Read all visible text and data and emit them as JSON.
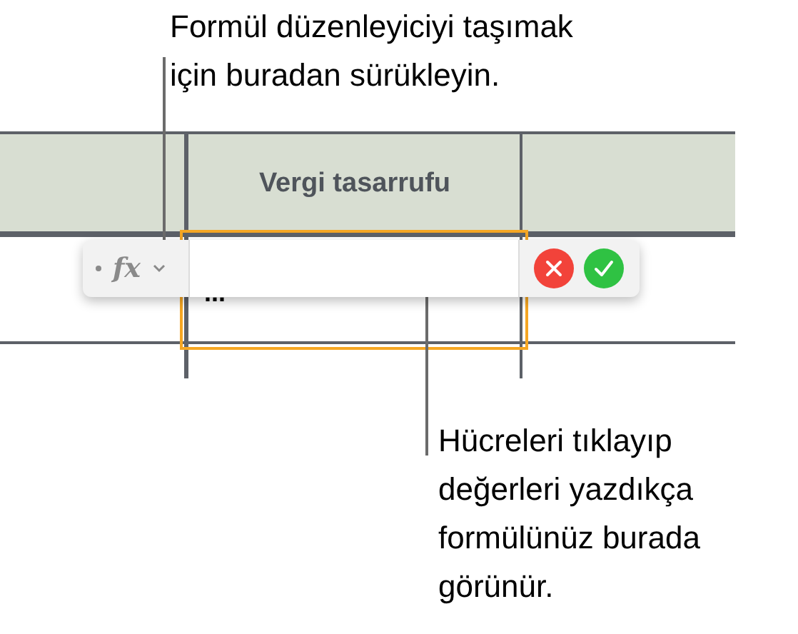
{
  "callouts": [
    {
      "text": "Formül düzenleyiciyi taşımak\niçin buradan sürükleyin."
    },
    {
      "text": "Hücreleri tıklayıp\ndeğerleri yazdıkça\nformülünüz burada\ngörünür."
    }
  ],
  "table": {
    "header": "Vergi tasarrufu",
    "cell": "..."
  },
  "formula_editor": {
    "icon_text": "fx"
  }
}
